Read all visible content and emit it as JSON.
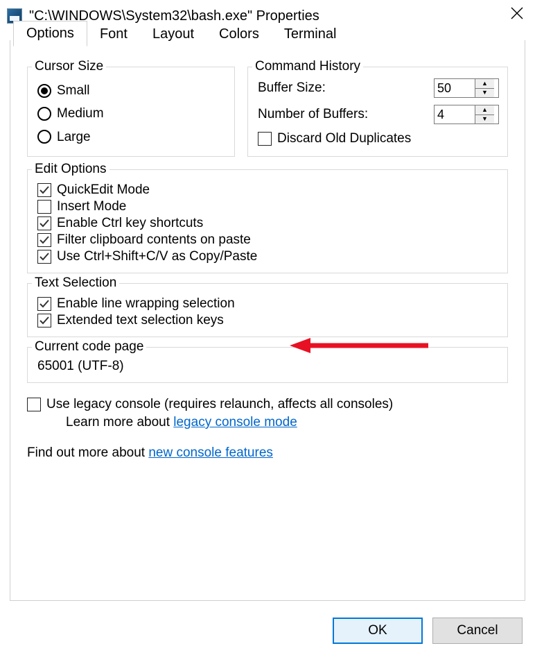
{
  "window": {
    "title": "\"C:\\WINDOWS\\System32\\bash.exe\" Properties"
  },
  "tabs": {
    "options": "Options",
    "font": "Font",
    "layout": "Layout",
    "colors": "Colors",
    "terminal": "Terminal"
  },
  "cursor": {
    "legend": "Cursor Size",
    "small": "Small",
    "medium": "Medium",
    "large": "Large"
  },
  "history": {
    "legend": "Command History",
    "buffer_size_label": "Buffer Size:",
    "buffer_size_value": "50",
    "num_buffers_label": "Number of Buffers:",
    "num_buffers_value": "4",
    "discard_label": "Discard Old Duplicates"
  },
  "edit": {
    "legend": "Edit Options",
    "quickedit": "QuickEdit Mode",
    "insert": "Insert Mode",
    "ctrlkeys": "Enable Ctrl key shortcuts",
    "filter": "Filter clipboard contents on paste",
    "ctrlshift": "Use Ctrl+Shift+C/V as Copy/Paste"
  },
  "textsel": {
    "legend": "Text Selection",
    "wrap": "Enable line wrapping selection",
    "ext": "Extended text selection keys"
  },
  "codepage": {
    "legend": "Current code page",
    "value": "65001 (UTF-8)"
  },
  "legacy": {
    "checkbox": "Use legacy console (requires relaunch, affects all consoles)",
    "learn_prefix": "Learn more about ",
    "learn_link": "legacy console mode"
  },
  "footer": {
    "find_prefix": "Find out more about ",
    "find_link": "new console features"
  },
  "buttons": {
    "ok": "OK",
    "cancel": "Cancel"
  }
}
